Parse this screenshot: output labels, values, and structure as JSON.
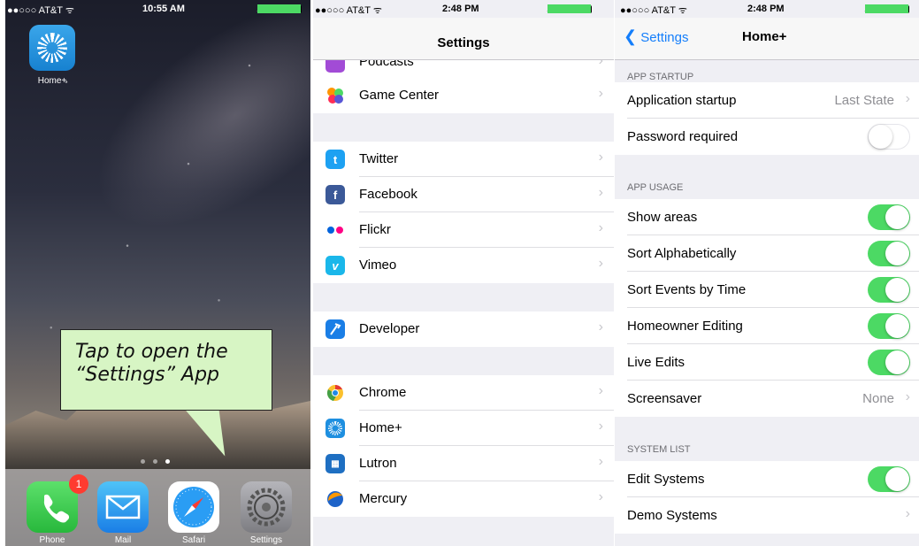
{
  "panel1": {
    "status": {
      "carrier": "●●○○○ AT&T ᯤ",
      "time": "10:55 AM",
      "battery": "100%"
    },
    "homeplus_label": "Home+",
    "callout_line1": "Tap to open the",
    "callout_line2": "“Settings” App",
    "dock": {
      "phone": "Phone",
      "mail": "Mail",
      "safari": "Safari",
      "settings": "Settings"
    },
    "phone_badge": "1"
  },
  "panel2": {
    "status": {
      "carrier": "●●○○○ AT&T ᯤ",
      "time": "2:48 PM",
      "battery": "100%"
    },
    "title": "Settings",
    "rows": {
      "podcasts": "Podcasts",
      "gamecenter": "Game Center",
      "twitter": "Twitter",
      "facebook": "Facebook",
      "flickr": "Flickr",
      "vimeo": "Vimeo",
      "developer": "Developer",
      "chrome": "Chrome",
      "homeplus": "Home+",
      "lutron": "Lutron",
      "mercury": "Mercury"
    }
  },
  "panel3": {
    "status": {
      "carrier": "●●○○○ AT&T ᯤ",
      "time": "2:48 PM",
      "battery": "100%"
    },
    "back": "Settings",
    "title": "Home+",
    "sections": {
      "startup": "APP STARTUP",
      "usage": "APP USAGE",
      "system": "SYSTEM LIST"
    },
    "rows": {
      "app_startup": "Application startup",
      "app_startup_value": "Last State",
      "password": "Password required",
      "show_areas": "Show areas",
      "sort_alpha": "Sort Alphabetically",
      "sort_events": "Sort Events by Time",
      "homeowner": "Homeowner Editing",
      "live_edits": "Live Edits",
      "screensaver": "Screensaver",
      "screensaver_value": "None",
      "edit_systems": "Edit Systems",
      "demo_systems": "Demo Systems"
    },
    "toggles": {
      "password": false,
      "show_areas": true,
      "sort_alpha": true,
      "sort_events": true,
      "homeowner": true,
      "live_edits": true,
      "edit_systems": true
    }
  },
  "colors": {
    "ios_blue": "#147efb",
    "ios_green": "#4cd964",
    "callout_bg": "#d7f5c4",
    "badge_red": "#ff3b30"
  }
}
